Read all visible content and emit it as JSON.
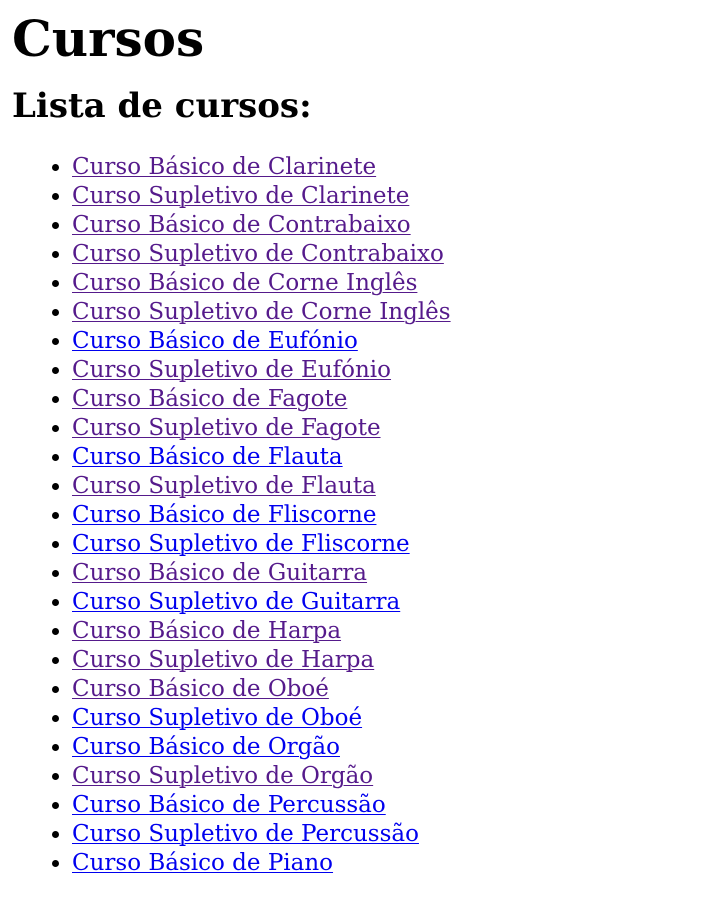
{
  "page": {
    "title": "Cursos",
    "subtitle": "Lista de cursos:"
  },
  "colors": {
    "link": "#0000ee",
    "visited_link": "#551a8b",
    "text": "#000000",
    "background": "#ffffff"
  },
  "courses": [
    {
      "label": "Curso Básico de Clarinete",
      "visited": true
    },
    {
      "label": "Curso Supletivo de Clarinete",
      "visited": true
    },
    {
      "label": "Curso Básico de Contrabaixo",
      "visited": true
    },
    {
      "label": "Curso Supletivo de Contrabaixo",
      "visited": true
    },
    {
      "label": "Curso Básico de Corne Inglês",
      "visited": true
    },
    {
      "label": "Curso Supletivo de Corne Inglês",
      "visited": true
    },
    {
      "label": "Curso Básico de Eufónio",
      "visited": false
    },
    {
      "label": "Curso Supletivo de Eufónio",
      "visited": true
    },
    {
      "label": "Curso Básico de Fagote",
      "visited": true
    },
    {
      "label": "Curso Supletivo de Fagote",
      "visited": true
    },
    {
      "label": "Curso Básico de Flauta",
      "visited": false
    },
    {
      "label": "Curso Supletivo de Flauta",
      "visited": true
    },
    {
      "label": "Curso Básico de Fliscorne",
      "visited": false
    },
    {
      "label": "Curso Supletivo de Fliscorne",
      "visited": false
    },
    {
      "label": "Curso Básico de Guitarra",
      "visited": true
    },
    {
      "label": "Curso Supletivo de Guitarra",
      "visited": false
    },
    {
      "label": "Curso Básico de Harpa",
      "visited": true
    },
    {
      "label": "Curso Supletivo de Harpa",
      "visited": true
    },
    {
      "label": "Curso Básico de Oboé",
      "visited": true
    },
    {
      "label": "Curso Supletivo de Oboé",
      "visited": false
    },
    {
      "label": "Curso Básico de Orgão",
      "visited": false
    },
    {
      "label": "Curso Supletivo de Orgão",
      "visited": true
    },
    {
      "label": "Curso Básico de Percussão",
      "visited": false
    },
    {
      "label": "Curso Supletivo de Percussão",
      "visited": false
    },
    {
      "label": "Curso Básico de Piano",
      "visited": false
    }
  ]
}
